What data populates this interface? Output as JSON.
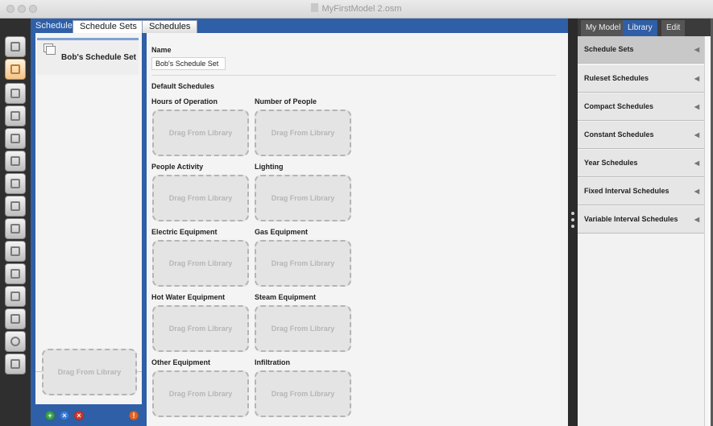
{
  "window": {
    "title": "MyFirstModel 2.osm"
  },
  "left_toolbar": {
    "icons": [
      "site-icon",
      "schedules-icon",
      "constructions-icon",
      "loads-icon",
      "space-types-icon",
      "geometry-icon",
      "facility-icon",
      "spaces-icon",
      "thermal-zones-icon",
      "hvac-systems-icon",
      "output-variables-icon",
      "simulation-settings-icon",
      "scripts-icon",
      "run-icon",
      "results-icon"
    ]
  },
  "tabs": {
    "schedules_blue": "Schedules",
    "schedule_sets": "Schedule Sets",
    "schedules": "Schedules"
  },
  "list": {
    "items": [
      {
        "label": "Bob's Schedule Set"
      }
    ],
    "drop_label": "Drag From Library"
  },
  "editor": {
    "name_label": "Name",
    "name_value": "Bob's Schedule Set",
    "default_schedules_label": "Default Schedules",
    "drop_label": "Drag From Library",
    "fields": [
      {
        "label": "Hours of Operation"
      },
      {
        "label": "Number of People"
      },
      {
        "label": "People Activity"
      },
      {
        "label": "Lighting"
      },
      {
        "label": "Electric Equipment"
      },
      {
        "label": "Gas Equipment"
      },
      {
        "label": "Hot Water Equipment"
      },
      {
        "label": "Steam Equipment"
      },
      {
        "label": "Other Equipment"
      },
      {
        "label": "Infiltration"
      }
    ]
  },
  "right_panel": {
    "tabs": {
      "my_model": "My Model",
      "library": "Library",
      "edit": "Edit"
    },
    "items": [
      {
        "label": "Schedule Sets"
      },
      {
        "label": "Ruleset Schedules"
      },
      {
        "label": "Compact Schedules"
      },
      {
        "label": "Constant Schedules"
      },
      {
        "label": "Year Schedules"
      },
      {
        "label": "Fixed Interval Schedules"
      },
      {
        "label": "Variable Interval Schedules"
      }
    ],
    "arrow": "◀"
  },
  "colors": {
    "accent_blue": "#2f5fa6",
    "toolbar_dark": "#2f2f2f",
    "library_selected": "#c8c8c8"
  }
}
